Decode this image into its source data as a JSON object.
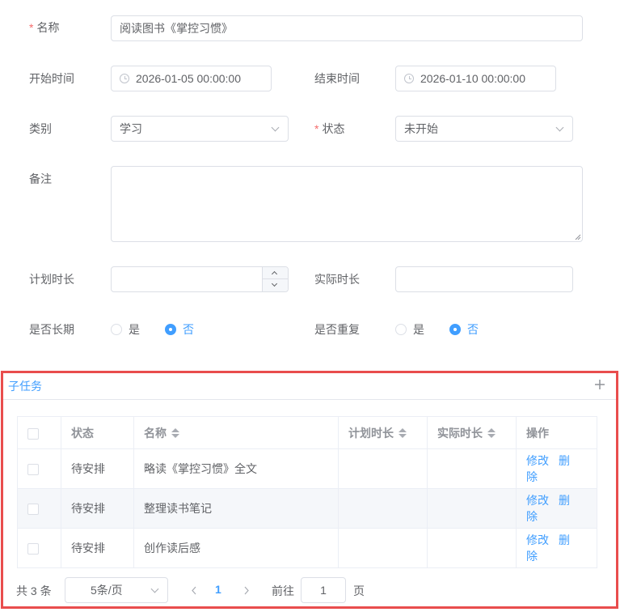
{
  "form": {
    "name": {
      "label": "名称",
      "value": "阅读图书《掌控习惯》"
    },
    "start_time": {
      "label": "开始时间",
      "value": "2026-01-05 00:00:00"
    },
    "end_time": {
      "label": "结束时间",
      "value": "2026-01-10 00:00:00"
    },
    "category": {
      "label": "类别",
      "value": "学习"
    },
    "status": {
      "label": "状态",
      "value": "未开始"
    },
    "remark": {
      "label": "备注",
      "value": ""
    },
    "planned_duration": {
      "label": "计划时长",
      "value": ""
    },
    "actual_duration": {
      "label": "实际时长",
      "value": ""
    },
    "long_term": {
      "label": "是否长期",
      "options": [
        "是",
        "否"
      ],
      "selected": "否"
    },
    "repeat": {
      "label": "是否重复",
      "options": [
        "是",
        "否"
      ],
      "selected": "否"
    }
  },
  "subtasks": {
    "title": "子任务",
    "add_icon": "plus-icon",
    "columns": [
      "状态",
      "名称",
      "计划时长",
      "实际时长",
      "操作"
    ],
    "rows": [
      {
        "status": "待安排",
        "name": "略读《掌控习惯》全文",
        "planned": "",
        "actual": "",
        "edit": "修改",
        "delete": "删除"
      },
      {
        "status": "待安排",
        "name": "整理读书笔记",
        "planned": "",
        "actual": "",
        "edit": "修改",
        "delete": "删除"
      },
      {
        "status": "待安排",
        "name": "创作读后感",
        "planned": "",
        "actual": "",
        "edit": "修改",
        "delete": "删除"
      }
    ],
    "pagination": {
      "total_text": "共 3 条",
      "page_size": "5条/页",
      "current_page": "1",
      "goto_label": "前往",
      "goto_value": "1",
      "page_unit": "页"
    }
  },
  "colors": {
    "primary": "#409eff",
    "required": "#f56c6c",
    "highlight_border": "#e94d4d"
  }
}
